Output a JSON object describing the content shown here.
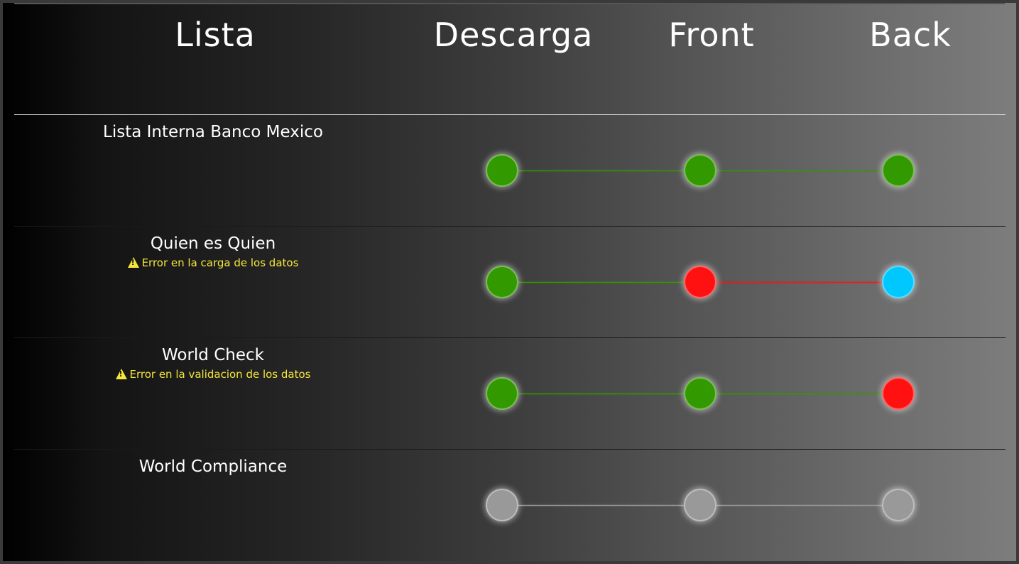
{
  "header": {
    "lista": "Lista",
    "descarga": "Descarga",
    "front": "Front",
    "back": "Back"
  },
  "colors": {
    "ok": "#339900",
    "error": "#ff1111",
    "info": "#00c8ff",
    "inactive": "#999999",
    "warning_text": "#f5e63a",
    "divider": "#dddddd"
  },
  "rows": [
    {
      "name": "Lista Interna Banco Mexico",
      "error": "",
      "statuses": [
        "ok",
        "ok",
        "ok"
      ],
      "links": [
        "ok",
        "ok"
      ]
    },
    {
      "name": "Quien es Quien",
      "error": "Error en la carga de los datos",
      "statuses": [
        "ok",
        "error",
        "info"
      ],
      "links": [
        "ok",
        "error"
      ]
    },
    {
      "name": "World Check",
      "error": "Error en la validacion de los datos",
      "statuses": [
        "ok",
        "ok",
        "error"
      ],
      "links": [
        "ok",
        "ok"
      ]
    },
    {
      "name": "World Compliance",
      "error": "",
      "statuses": [
        "inactive",
        "inactive",
        "inactive"
      ],
      "links": [
        "inactive",
        "inactive"
      ]
    }
  ]
}
